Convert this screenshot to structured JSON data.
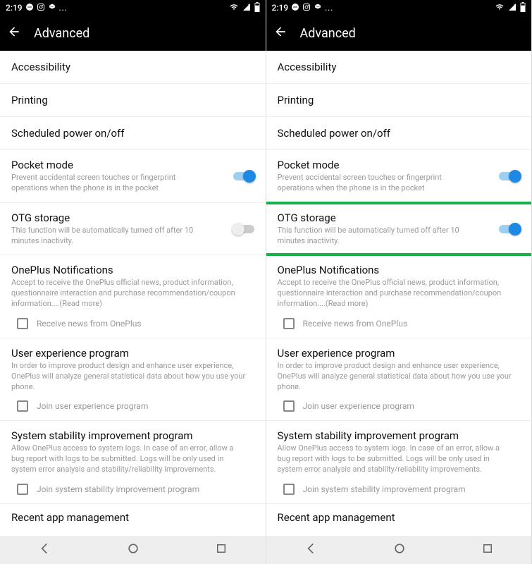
{
  "status": {
    "time": "2:19",
    "right_icons": [
      "wifi",
      "signal-x",
      "battery"
    ]
  },
  "appbar": {
    "title": "Advanced"
  },
  "rows": {
    "accessibility": "Accessibility",
    "printing": "Printing",
    "scheduled": "Scheduled power on/off",
    "pocket": {
      "title": "Pocket mode",
      "sub": "Prevent accidental screen touches or fingerprint operations when the phone is in the pocket"
    },
    "otg": {
      "title": "OTG storage",
      "sub": "This function will be automatically turned off after 10 minutes inactivity."
    },
    "notif": {
      "title": "OnePlus Notifications",
      "sub": "Accept to receive the OnePlus official news, product information, questionnaire interaction and purchase recommendation/coupon information....(Read more)",
      "cb": "Receive news from OnePlus"
    },
    "uep": {
      "title": "User experience program",
      "sub": "In order to improve product design and enhance user experience, OnePlus will analyze general statistical data about how you use your phone.",
      "cb": "Join user experience program"
    },
    "ssip": {
      "title": "System stability improvement program",
      "sub": "Allow OnePlus access to system logs. In case of an error, allow a bug report with logs to be submitted. Logs will be only used in system error analysis and stability/reliability improvements.",
      "cb": "Join system stability improvement program"
    },
    "recent": "Recent app management"
  },
  "left": {
    "otg_on": false
  },
  "right": {
    "otg_on": true
  }
}
